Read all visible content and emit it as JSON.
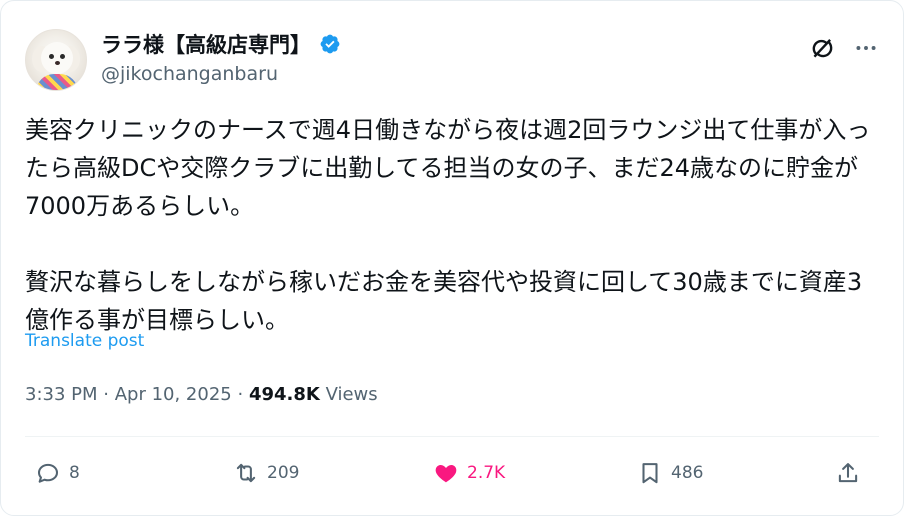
{
  "author": {
    "display_name": "ララ様【高級店専門】",
    "handle": "@jikochanganbaru",
    "verified_color": "#1d9bf0"
  },
  "post": {
    "text": "美容クリニックのナースで週4日働きながら夜は週2回ラウンジ出て仕事が入ったら高級DCや交際クラブに出勤してる担当の女の子、まだ24歳なのに貯金が7000万あるらしい。\n\n贅沢な暮らしをしながら稼いだお金を美容代や投資に回して30歳までに資産3億作る事が目標らしい。",
    "translate_label": "Translate post",
    "time": "3:33 PM",
    "date": "Apr 10, 2025",
    "views_count": "494.8K",
    "views_label": "Views"
  },
  "actions": {
    "replies": "8",
    "reposts": "209",
    "likes": "2.7K",
    "bookmarks": "486"
  },
  "colors": {
    "accent": "#1d9bf0",
    "like": "#f91880",
    "muted": "#536471",
    "text": "#0f1419"
  },
  "icons": {
    "header": [
      "grok-icon",
      "more-icon"
    ],
    "actions": [
      "reply-icon",
      "repost-icon",
      "like-icon",
      "bookmark-icon",
      "share-icon"
    ]
  }
}
